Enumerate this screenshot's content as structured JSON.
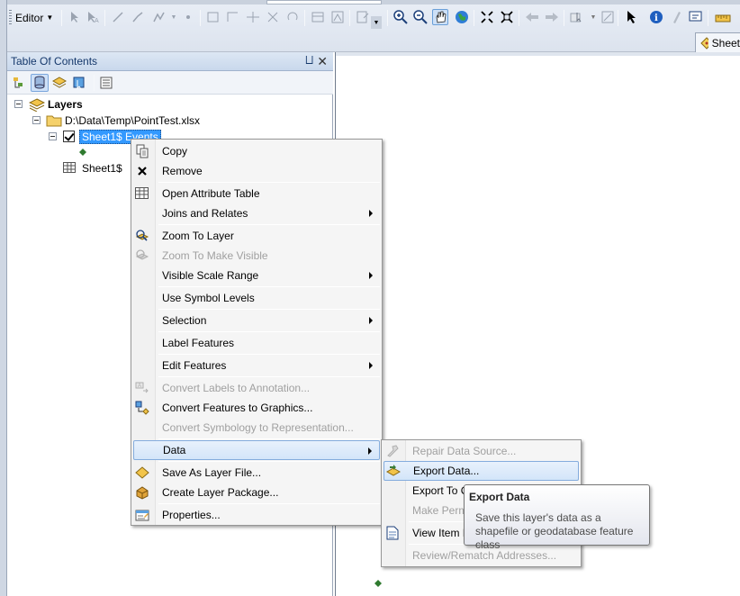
{
  "toolbar": {
    "editor_label": "Editor",
    "sheet_tab_label": "Sheet"
  },
  "toc": {
    "title": "Table Of Contents",
    "pin_glyph": "⨆",
    "close_glyph": "✕"
  },
  "tree": {
    "layers_label": "Layers",
    "source_path": "D:\\Data\\Temp\\PointTest.xlsx",
    "event_layer_label": "Sheet1$ Events",
    "table_label": "Sheet1$"
  },
  "context_menu": {
    "items": [
      {
        "label": "Copy",
        "icon": "copy-icon",
        "enabled": true
      },
      {
        "label": "Remove",
        "icon": "remove-icon",
        "enabled": true
      },
      {
        "label": "Open Attribute Table",
        "icon": "table-icon",
        "enabled": true
      },
      {
        "label": "Joins and Relates",
        "enabled": true,
        "submenu": true
      },
      {
        "label": "Zoom To Layer",
        "icon": "zoom-to-layer-icon",
        "enabled": true
      },
      {
        "label": "Zoom To Make Visible",
        "icon": "zoom-visible-icon",
        "enabled": false
      },
      {
        "label": "Visible Scale Range",
        "enabled": true,
        "submenu": true
      },
      {
        "label": "Use Symbol Levels",
        "enabled": true
      },
      {
        "label": "Selection",
        "enabled": true,
        "submenu": true
      },
      {
        "label": "Label Features",
        "enabled": true
      },
      {
        "label": "Edit Features",
        "enabled": true,
        "submenu": true
      },
      {
        "label": "Convert Labels to Annotation...",
        "icon": "convert-labels-icon",
        "enabled": false
      },
      {
        "label": "Convert Features to Graphics...",
        "icon": "convert-graphics-icon",
        "enabled": true
      },
      {
        "label": "Convert Symbology to Representation...",
        "enabled": false
      },
      {
        "label": "Data",
        "enabled": true,
        "submenu": true,
        "highlighted": true
      },
      {
        "label": "Save As Layer File...",
        "icon": "layer-file-icon",
        "enabled": true
      },
      {
        "label": "Create Layer Package...",
        "icon": "layer-package-icon",
        "enabled": true
      },
      {
        "label": "Properties...",
        "icon": "properties-icon",
        "enabled": true
      }
    ]
  },
  "data_submenu": {
    "items": [
      {
        "label": "Repair Data Source...",
        "icon": "repair-icon",
        "enabled": false
      },
      {
        "label": "Export Data...",
        "icon": "export-data-icon",
        "enabled": true,
        "highlighted": true
      },
      {
        "label": "Export To C",
        "enabled": true
      },
      {
        "label": "Make Perm",
        "enabled": false
      },
      {
        "label": "View Item I",
        "icon": "view-item-icon",
        "enabled": true
      },
      {
        "label": "Review/Rematch Addresses...",
        "enabled": false
      }
    ]
  },
  "tooltip": {
    "title": "Export Data",
    "body": "Save this layer's data as a shapefile or geodatabase feature class"
  },
  "colors": {
    "selection": "#3399ff",
    "menu_hover_border": "#84acdd",
    "toc_title": "#15386b"
  }
}
